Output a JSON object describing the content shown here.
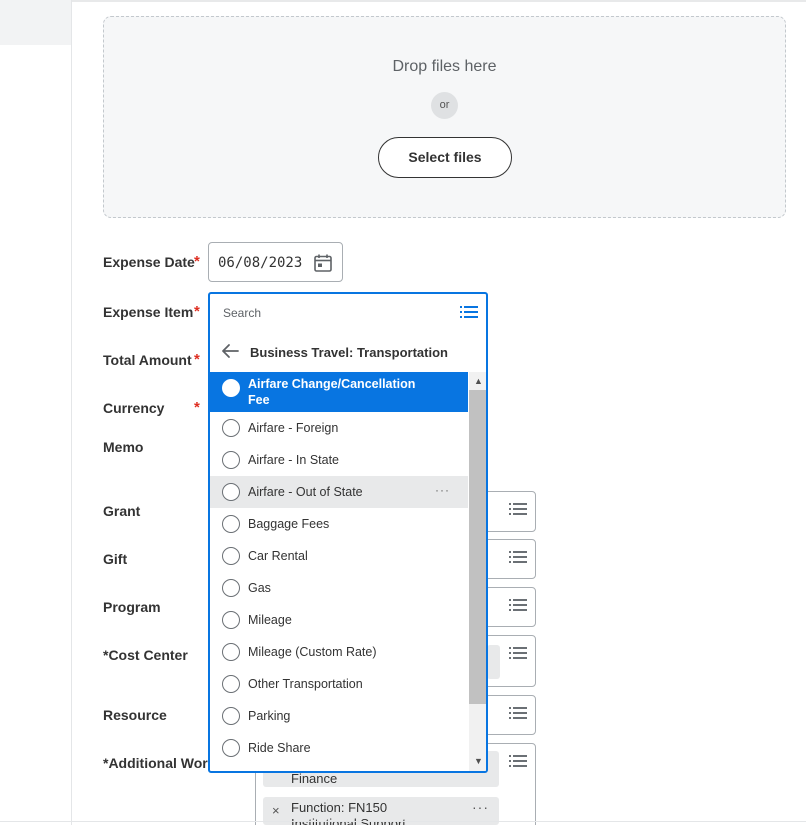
{
  "upload": {
    "drop_text": "Drop files here",
    "or_text": "or",
    "select_label": "Select files"
  },
  "form": {
    "fields": [
      {
        "label": "Expense Date",
        "required": true
      },
      {
        "label": "Expense Item",
        "required": true
      },
      {
        "label": "Total Amount",
        "required": true
      },
      {
        "label": "Currency",
        "required": true
      },
      {
        "label": "Memo"
      },
      {
        "label": "Grant"
      },
      {
        "label": "Gift"
      },
      {
        "label": "Program"
      },
      {
        "label": "*Cost Center"
      },
      {
        "label": "Resource"
      },
      {
        "label": "*Additional Work"
      }
    ],
    "required_marker": "*",
    "expense_date_value": "06/08/2023",
    "worktags": {
      "chip1_text": "Finance",
      "chip2_text": "Function: FN150",
      "chip2_text_line2": "Institutional Support",
      "remove_symbol": "×",
      "more_symbol": "···"
    }
  },
  "dropdown": {
    "search_placeholder": "Search",
    "category_title": "Business Travel: Transportation",
    "options": [
      {
        "label": "Airfare Change/Cancellation Fee",
        "line1": "Airfare Change/Cancellation",
        "line2": "Fee",
        "state": "selected"
      },
      {
        "label": "Airfare - Foreign"
      },
      {
        "label": "Airfare - In State"
      },
      {
        "label": "Airfare - Out of State",
        "state": "hover",
        "more": "···"
      },
      {
        "label": "Baggage Fees"
      },
      {
        "label": "Car Rental"
      },
      {
        "label": "Gas"
      },
      {
        "label": "Mileage"
      },
      {
        "label": "Mileage (Custom Rate)"
      },
      {
        "label": "Other Transportation"
      },
      {
        "label": "Parking"
      },
      {
        "label": "Ride Share"
      }
    ]
  },
  "colors": {
    "accent": "#0875e1",
    "required": "#de2e21",
    "hover": "#e8e9ea",
    "text": "#333333"
  },
  "icons": {
    "calendar": "calendar-icon",
    "prompt": "list-prompt-icon",
    "back": "back-arrow-icon",
    "radio": "radio-icon"
  }
}
